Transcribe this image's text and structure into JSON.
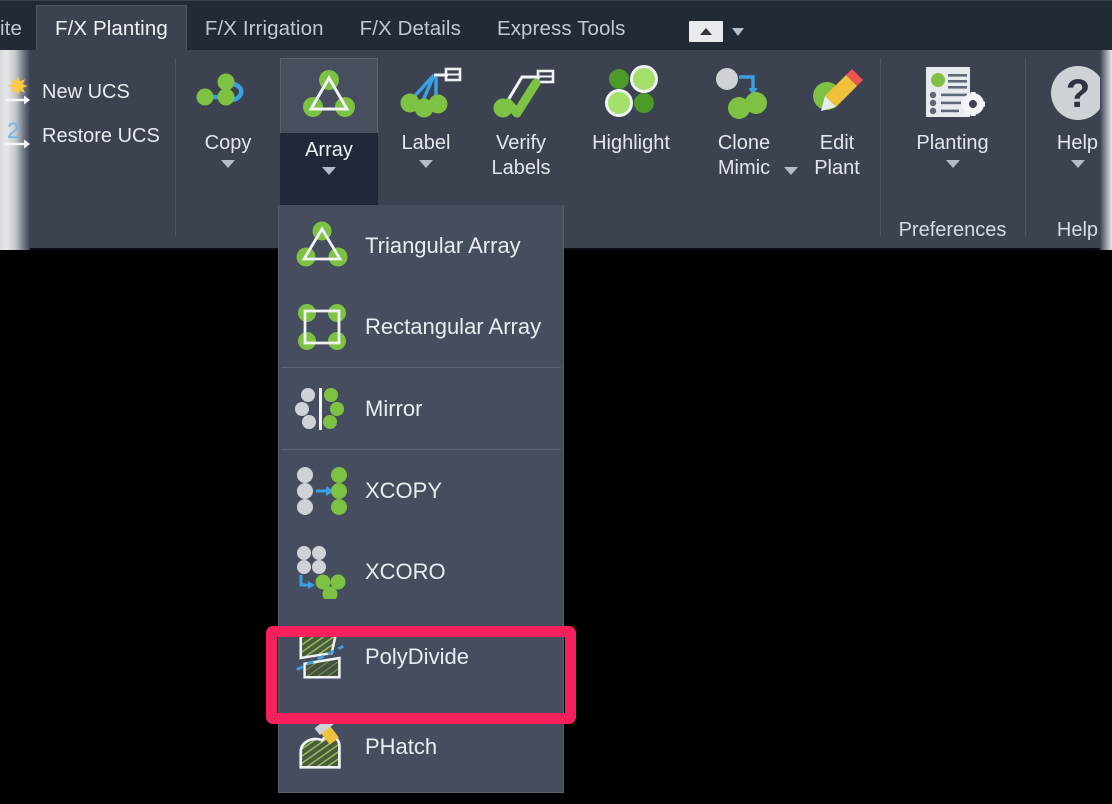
{
  "window": {
    "app": "AutoCAD Ribbon",
    "background_color": "#000000",
    "ribbon_bg": "#3c4250",
    "tabbar_bg": "#222a35",
    "menu_bg": "#464d5e",
    "highlight_color": "#f8215e",
    "accent_green": "#7dc242",
    "accent_blue": "#3aa0e0"
  },
  "tabs": [
    {
      "label": "ite",
      "active": false,
      "truncated": true,
      "name": "tab-fx-site"
    },
    {
      "label": "F/X Planting",
      "active": true,
      "truncated": false,
      "name": "tab-fx-planting"
    },
    {
      "label": "F/X Irrigation",
      "active": false,
      "truncated": false,
      "name": "tab-fx-irrigation"
    },
    {
      "label": "F/X Details",
      "active": false,
      "truncated": false,
      "name": "tab-fx-details"
    },
    {
      "label": "Express Tools",
      "active": false,
      "truncated": false,
      "name": "tab-express-tools"
    }
  ],
  "ribbon_toggle": {
    "icon": "caret-up-icon",
    "dropdown_icon": "chevron-down-icon"
  },
  "ucs_panel": {
    "items": [
      {
        "label": "New UCS",
        "icon": "new-ucs-star-icon"
      },
      {
        "label": "Restore UCS",
        "icon": "restore-ucs-icon"
      }
    ]
  },
  "ribbon_buttons": [
    {
      "label": "Copy",
      "label2": "",
      "icon": "copy-plants-icon",
      "has_caret": true,
      "active": false
    },
    {
      "label": "Array",
      "label2": "",
      "icon": "triangular-array-icon",
      "has_caret": true,
      "active": true
    },
    {
      "label": "Label",
      "label2": "",
      "icon": "label-plants-icon",
      "has_caret": true,
      "active": false
    },
    {
      "label": "Verify",
      "label2": "Labels",
      "icon": "verify-labels-icon",
      "has_caret": false,
      "active": false
    },
    {
      "label": "Highlight",
      "label2": "",
      "icon": "highlight-plants-icon",
      "has_caret": false,
      "active": false
    },
    {
      "label": "Clone",
      "label2": "Mimic",
      "icon": "clone-mimic-icon",
      "has_caret": true,
      "active": false
    },
    {
      "label": "Edit",
      "label2": "Plant",
      "icon": "edit-plant-icon",
      "has_caret": false,
      "active": false
    },
    {
      "label": "Planting",
      "label2": "",
      "icon": "planting-preferences-icon",
      "has_caret": true,
      "active": false
    },
    {
      "label": "Help",
      "label2": "",
      "icon": "help-question-icon",
      "has_caret": true,
      "active": false
    }
  ],
  "panel_titles": {
    "preferences": "Preferences",
    "help": "Help"
  },
  "array_menu": {
    "items": [
      {
        "label": "Triangular Array",
        "icon": "triangular-array-icon",
        "sep_after": false,
        "highlighted": false
      },
      {
        "label": "Rectangular Array",
        "icon": "rectangular-array-icon",
        "sep_after": true,
        "highlighted": false
      },
      {
        "label": "Mirror",
        "icon": "mirror-icon",
        "sep_after": true,
        "highlighted": false
      },
      {
        "label": "XCOPY",
        "icon": "xcopy-icon",
        "sep_after": false,
        "highlighted": false
      },
      {
        "label": "XCORO",
        "icon": "xcoro-icon",
        "sep_after": false,
        "highlighted": false
      },
      {
        "label": "PolyDivide",
        "icon": "polydivide-icon",
        "sep_after": false,
        "highlighted": true
      },
      {
        "label": "PHatch",
        "icon": "phatch-icon",
        "sep_after": false,
        "highlighted": false
      }
    ]
  }
}
